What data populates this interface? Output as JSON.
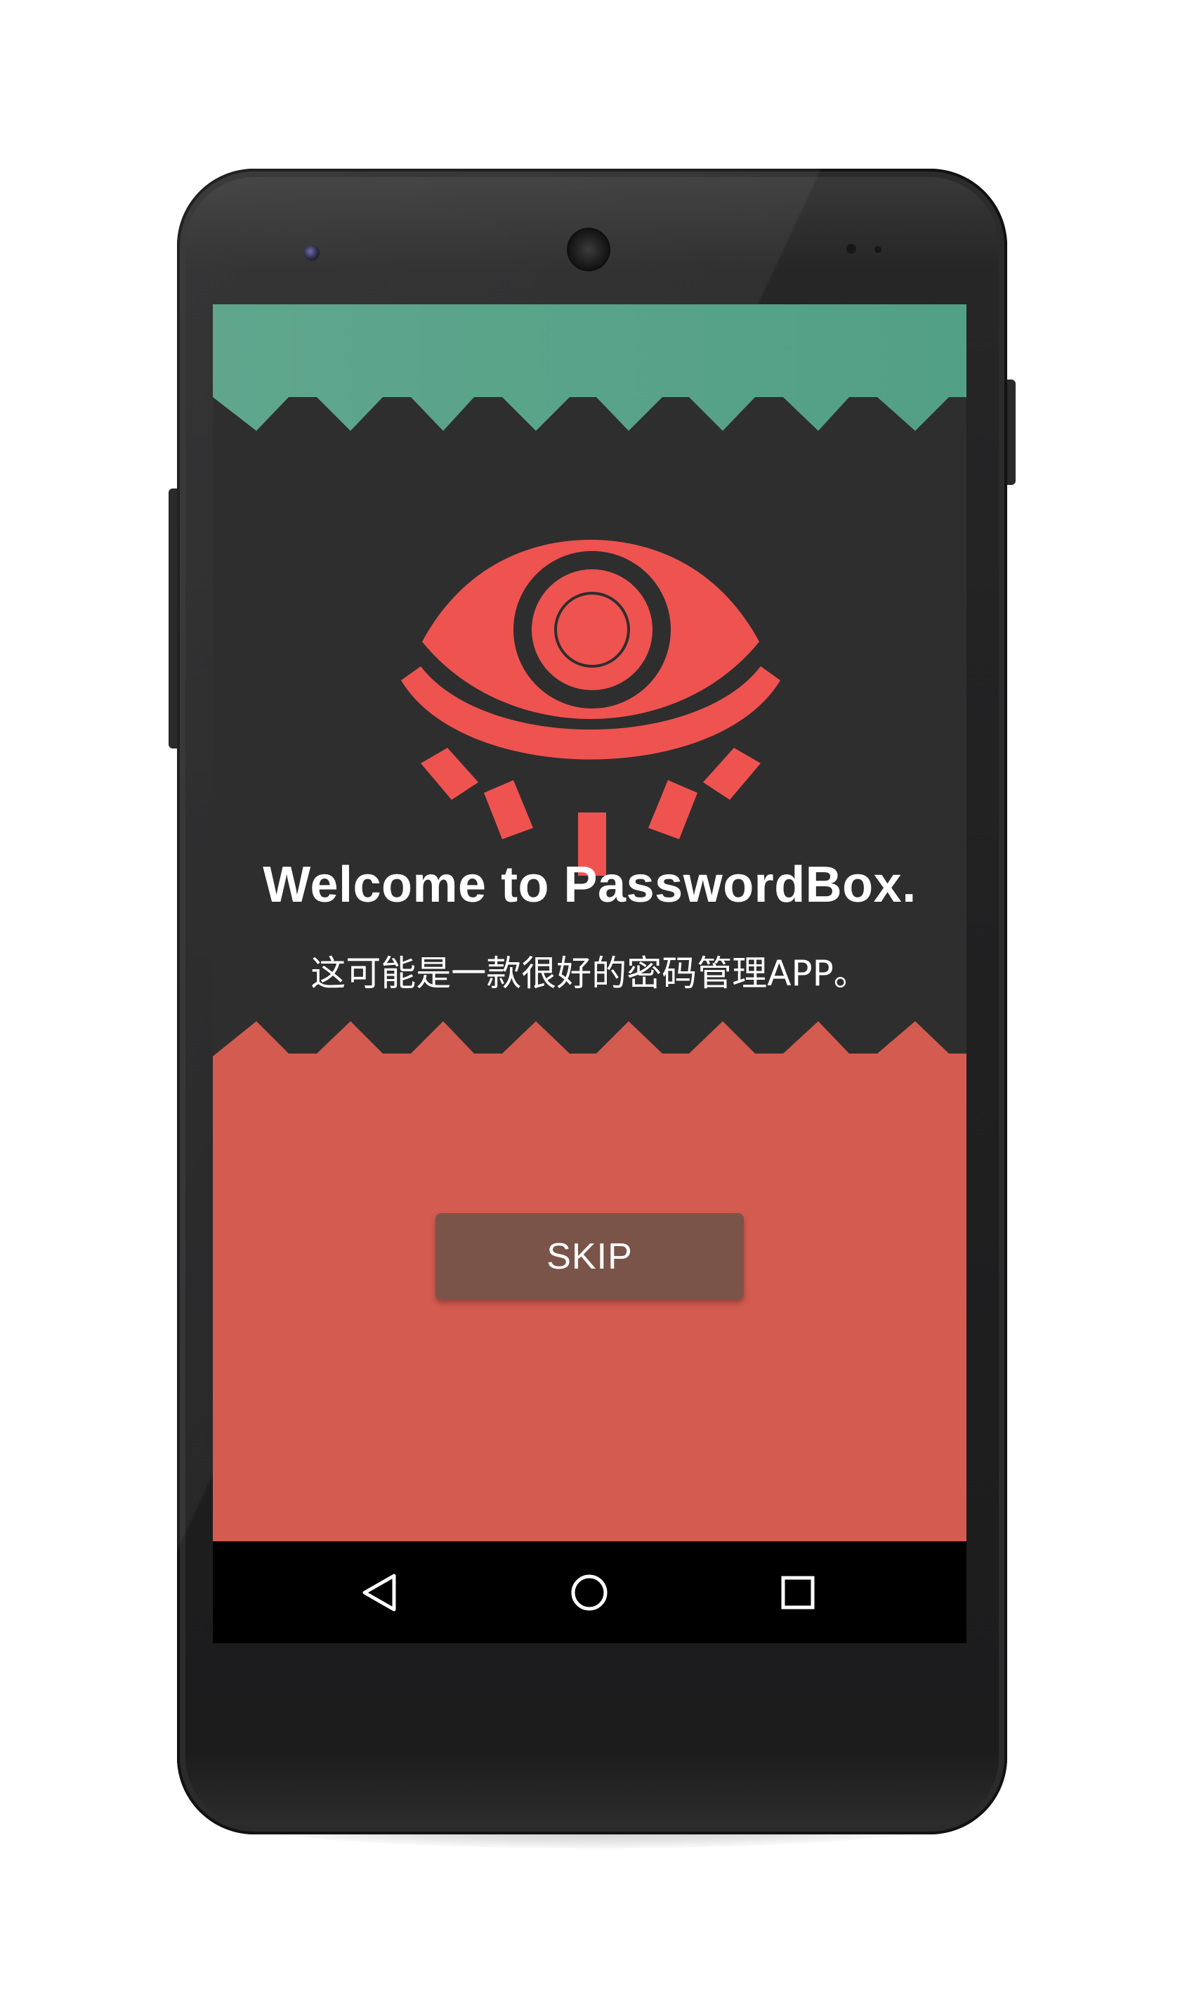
{
  "screen": {
    "welcome_title": "Welcome to PasswordBox.",
    "welcome_subtitle": "这可能是一款很好的密码管理APP。",
    "skip_label": "SKIP"
  },
  "icons": {
    "logo": "eye-icon",
    "nav_back": "back-triangle-icon",
    "nav_home": "home-circle-icon",
    "nav_recents": "recents-square-icon"
  },
  "colors": {
    "top_band": "#52a086",
    "bottom_band": "#d45b50",
    "background": "#2e2e2e",
    "logo": "#ee5350",
    "skip_button": "#7a5448",
    "nav_bar": "#000000"
  }
}
